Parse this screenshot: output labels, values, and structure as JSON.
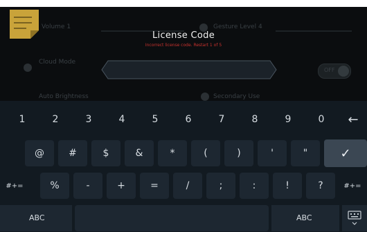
{
  "dialog": {
    "title": "License Code",
    "error": "Incorrect license code. Restart 1 of 5",
    "input_value": ""
  },
  "background": {
    "item1": "Volume 1",
    "item2": "Gesture Level 4",
    "item3": "Cloud Mode",
    "item4": "Auto Brightness",
    "item5": "Secondary Use",
    "toggle_text": "OFF"
  },
  "keyboard": {
    "row1": [
      "1",
      "2",
      "3",
      "4",
      "5",
      "6",
      "7",
      "8",
      "9",
      "0"
    ],
    "row2": [
      "@",
      "#",
      "$",
      "&",
      "*",
      "(",
      ")",
      "'",
      "\""
    ],
    "row3_left": "#+=",
    "row3": [
      "%",
      "-",
      "+",
      "=",
      "/",
      ";",
      ":",
      "!",
      "?"
    ],
    "row3_right": "#+=",
    "abc_left": "ABC",
    "abc_right": "ABC",
    "backspace": "←",
    "enter": "✓"
  },
  "icons": {
    "note": "note-icon",
    "backspace": "backspace-icon",
    "enter": "checkmark-icon",
    "hide": "keyboard-hide-icon"
  },
  "colors": {
    "error": "#c8322e",
    "note": "#c9a33a",
    "keyboard_bg": "#121a21",
    "key_bg": "#1d2731",
    "enter_bg": "#3b4753"
  }
}
